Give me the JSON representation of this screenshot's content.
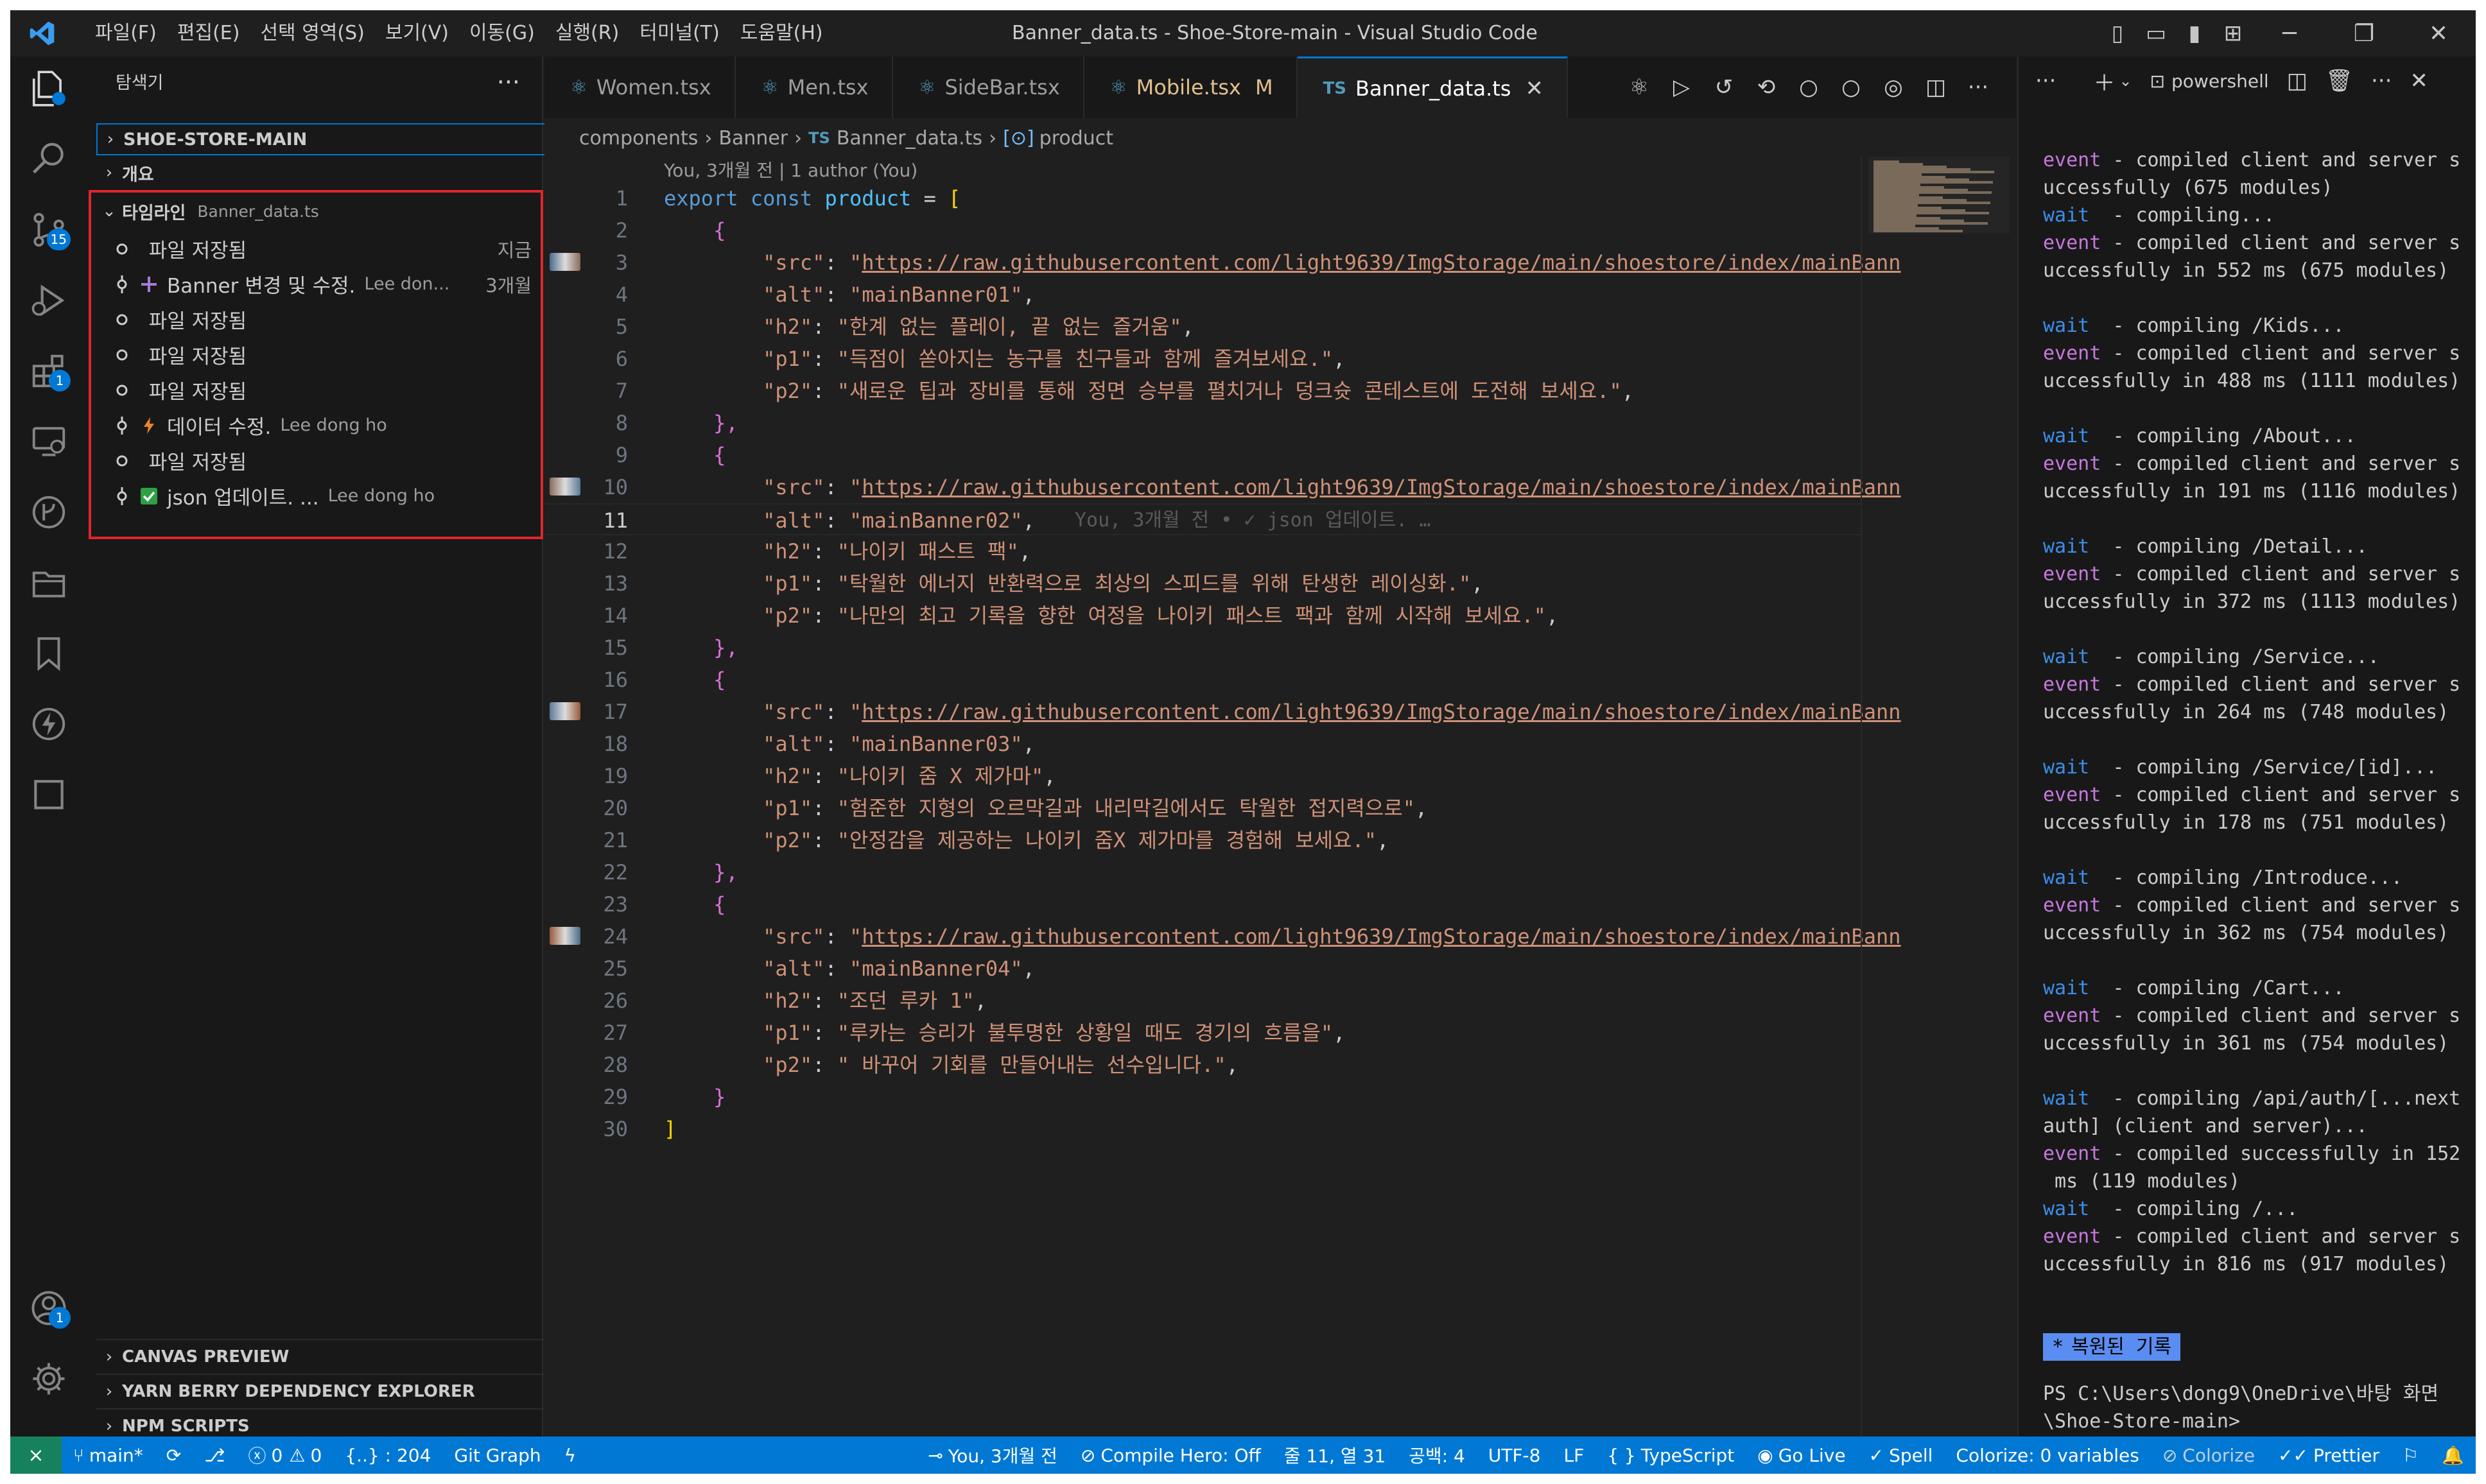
{
  "titlebar": {
    "menus": [
      "파일(F)",
      "편집(E)",
      "선택 영역(S)",
      "보기(V)",
      "이동(G)",
      "실행(R)",
      "터미널(T)",
      "도움말(H)"
    ],
    "title": "Banner_data.ts - Shoe-Store-main - Visual Studio Code"
  },
  "activity": {
    "scm_badge": "15",
    "extensions_badge": "1",
    "accounts_badge": "1"
  },
  "sidebar": {
    "header": "탐색기",
    "project": "SHOE-STORE-MAIN",
    "outline": "개요",
    "timeline_label": "타임라인",
    "timeline_file": "Banner_data.ts",
    "timeline": [
      {
        "label": "파일 저장됨",
        "author": "",
        "time": "지금",
        "icon": "circle-icon"
      },
      {
        "label": "Banner 변경 및 수정.",
        "author": "Lee don...",
        "time": "3개월",
        "icon": "sparkle-plus-icon"
      },
      {
        "label": "파일 저장됨",
        "author": "",
        "time": "",
        "icon": "circle-icon"
      },
      {
        "label": "파일 저장됨",
        "author": "",
        "time": "",
        "icon": "circle-icon"
      },
      {
        "label": "파일 저장됨",
        "author": "",
        "time": "",
        "icon": "circle-icon"
      },
      {
        "label": "데이터 수정.",
        "author": "Lee dong ho",
        "time": "",
        "icon": "zap-icon"
      },
      {
        "label": "파일 저장됨",
        "author": "",
        "time": "",
        "icon": "circle-icon"
      },
      {
        "label": "json 업데이트. ...",
        "author": "Lee dong ho",
        "time": "",
        "icon": "check-box-icon"
      }
    ],
    "bottom_sections": [
      "CANVAS PREVIEW",
      "YARN BERRY DEPENDENCY EXPLORER",
      "NPM SCRIPTS"
    ]
  },
  "tabs": [
    {
      "name": "Women.tsx",
      "modified": false,
      "active": false
    },
    {
      "name": "Men.tsx",
      "modified": false,
      "active": false
    },
    {
      "name": "SideBar.tsx",
      "modified": false,
      "active": false
    },
    {
      "name": "Mobile.tsx",
      "modified": true,
      "mark": "M",
      "active": false
    },
    {
      "name": "Banner_data.ts",
      "modified": false,
      "active": true
    }
  ],
  "breadcrumb": [
    "components",
    "Banner",
    "Banner_data.ts",
    "product"
  ],
  "codelens": "You, 3개월 전 | 1 author (You)",
  "code": {
    "current_line": 11,
    "inline_blame": "You, 3개월 전 • ✓ json 업데이트. …",
    "url": "https://raw.githubusercontent.com/light9639/ImgStorage/main/shoestore/index/mainBann",
    "items": [
      {
        "alt": "mainBanner01",
        "h2": "한계 없는 플레이, 끝 없는 즐거움",
        "p1": "득점이 쏟아지는 농구를 친구들과 함께 즐겨보세요.",
        "p2": "새로운 팁과 장비를 통해 정면 승부를 펼치거나 덩크슛 콘테스트에 도전해 보세요."
      },
      {
        "alt": "mainBanner02",
        "h2": "나이키 패스트 팩",
        "p1": "탁월한 에너지 반환력으로 최상의 스피드를 위해 탄생한 레이싱화.",
        "p2": "나만의 최고 기록을 향한 여정을 나이키 패스트 팩과 함께 시작해 보세요."
      },
      {
        "alt": "mainBanner03",
        "h2": "나이키 줌 X 제가마",
        "p1": "험준한 지형의 오르막길과 내리막길에서도 탁월한 접지력으로",
        "p2": "안정감을 제공하는 나이키 줌X 제가마를 경험해 보세요."
      },
      {
        "alt": "mainBanner04",
        "h2": "조던 루카 1",
        "p1": "루카는 승리가 불투명한 상황일 때도 경기의 흐름을",
        "p2": " 바꾸어 기회를 만들어내는 선수입니다."
      }
    ]
  },
  "terminal": {
    "shell": "powershell",
    "lines": [
      {
        "t": "event",
        "r": " - compiled client and server s"
      },
      {
        "t": "",
        "r": "uccessfully (675 modules)"
      },
      {
        "t": "wait",
        "r": "  - compiling..."
      },
      {
        "t": "event",
        "r": " - compiled client and server s"
      },
      {
        "t": "",
        "r": "uccessfully in 552 ms (675 modules)"
      },
      {
        "t": "blank",
        "r": ""
      },
      {
        "t": "wait",
        "r": "  - compiling /Kids..."
      },
      {
        "t": "event",
        "r": " - compiled client and server s"
      },
      {
        "t": "",
        "r": "uccessfully in 488 ms (1111 modules)"
      },
      {
        "t": "blank",
        "r": ""
      },
      {
        "t": "wait",
        "r": "  - compiling /About..."
      },
      {
        "t": "event",
        "r": " - compiled client and server s"
      },
      {
        "t": "",
        "r": "uccessfully in 191 ms (1116 modules)"
      },
      {
        "t": "blank",
        "r": ""
      },
      {
        "t": "wait",
        "r": "  - compiling /Detail..."
      },
      {
        "t": "event",
        "r": " - compiled client and server s"
      },
      {
        "t": "",
        "r": "uccessfully in 372 ms (1113 modules)"
      },
      {
        "t": "blank",
        "r": ""
      },
      {
        "t": "wait",
        "r": "  - compiling /Service..."
      },
      {
        "t": "event",
        "r": " - compiled client and server s"
      },
      {
        "t": "",
        "r": "uccessfully in 264 ms (748 modules)"
      },
      {
        "t": "blank",
        "r": ""
      },
      {
        "t": "wait",
        "r": "  - compiling /Service/[id]..."
      },
      {
        "t": "event",
        "r": " - compiled client and server s"
      },
      {
        "t": "",
        "r": "uccessfully in 178 ms (751 modules)"
      },
      {
        "t": "blank",
        "r": ""
      },
      {
        "t": "wait",
        "r": "  - compiling /Introduce..."
      },
      {
        "t": "event",
        "r": " - compiled client and server s"
      },
      {
        "t": "",
        "r": "uccessfully in 362 ms (754 modules)"
      },
      {
        "t": "blank",
        "r": ""
      },
      {
        "t": "wait",
        "r": "  - compiling /Cart..."
      },
      {
        "t": "event",
        "r": " - compiled client and server s"
      },
      {
        "t": "",
        "r": "uccessfully in 361 ms (754 modules)"
      },
      {
        "t": "blank",
        "r": ""
      },
      {
        "t": "wait",
        "r": "  - compiling /api/auth/[...next"
      },
      {
        "t": "",
        "r": "auth] (client and server)..."
      },
      {
        "t": "event",
        "r": " - compiled successfully in 152"
      },
      {
        "t": "",
        "r": " ms (119 modules)"
      },
      {
        "t": "wait",
        "r": "  - compiling /..."
      },
      {
        "t": "event",
        "r": " - compiled client and server s"
      },
      {
        "t": "",
        "r": "uccessfully in 816 ms (917 modules)"
      }
    ],
    "restored_mark": "*",
    "restored": "복원된 기록",
    "prompt1": "PS C:\\Users\\dong9\\OneDrive\\바탕 화면",
    "prompt2": "\\Shoe-Store-main>"
  },
  "status": {
    "branch": "main*",
    "errors": "0",
    "warnings": "0",
    "brackets": "{..} : 204",
    "git_graph": "Git Graph",
    "blame": "You, 3개월 전",
    "compile_hero": "Compile Hero: Off",
    "position": "줄 11, 열 31",
    "spaces": "공백: 4",
    "encoding": "UTF-8",
    "eol": "LF",
    "language": "TypeScript",
    "golive": "Go Live",
    "spell": "Spell",
    "colorize_vars": "Colorize: 0 variables",
    "colorize": "Colorize",
    "prettier": "Prettier"
  },
  "colors": {
    "accent": "#0078d4",
    "highlight_box": "#e0242b",
    "string": "#ce9178",
    "keyword": "#569cd6",
    "remote": "#16825d"
  }
}
